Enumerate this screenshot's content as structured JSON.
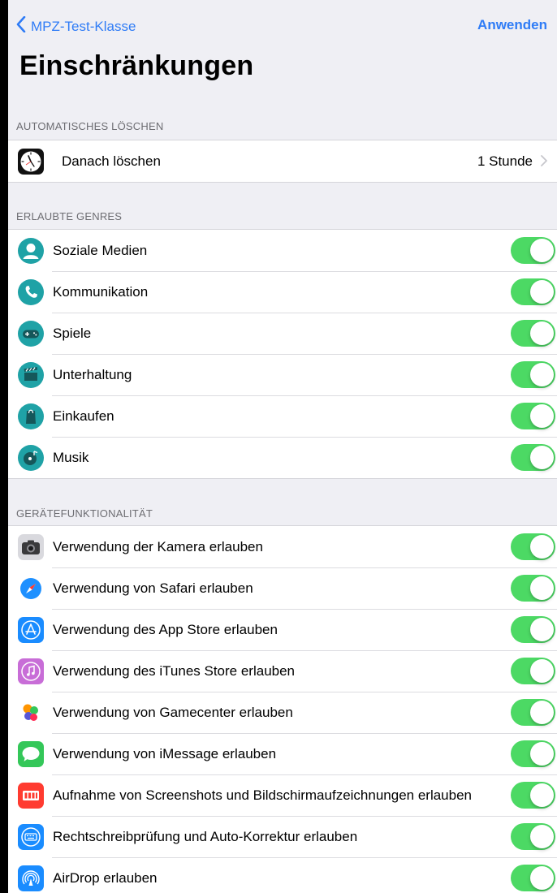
{
  "nav": {
    "back_label": "MPZ-Test-Klasse",
    "apply_label": "Anwenden"
  },
  "title": "Einschränkungen",
  "sections": {
    "auto_delete": {
      "header": "AUTOMATISCHES LÖSCHEN",
      "row": {
        "label": "Danach löschen",
        "value": "1 Stunde",
        "icon": "clock-icon"
      }
    },
    "genres": {
      "header": "ERLAUBTE GENRES",
      "items": [
        {
          "label": "Soziale Medien",
          "icon": "social-media-icon",
          "on": true
        },
        {
          "label": "Kommunikation",
          "icon": "phone-icon",
          "on": true
        },
        {
          "label": "Spiele",
          "icon": "gamepad-icon",
          "on": true
        },
        {
          "label": "Unterhaltung",
          "icon": "clapperboard-icon",
          "on": true
        },
        {
          "label": "Einkaufen",
          "icon": "shopping-bag-icon",
          "on": true
        },
        {
          "label": "Musik",
          "icon": "music-icon",
          "on": true
        }
      ]
    },
    "device": {
      "header": "GERÄTEFUNKTIONALITÄT",
      "items": [
        {
          "label": "Verwendung der Kamera erlauben",
          "icon": "camera-icon",
          "on": true
        },
        {
          "label": "Verwendung von Safari erlauben",
          "icon": "safari-icon",
          "on": true
        },
        {
          "label": "Verwendung des App Store erlauben",
          "icon": "app-store-icon",
          "on": true
        },
        {
          "label": "Verwendung des iTunes Store erlauben",
          "icon": "itunes-icon",
          "on": true
        },
        {
          "label": "Verwendung von Gamecenter erlauben",
          "icon": "game-center-icon",
          "on": true
        },
        {
          "label": "Verwendung von iMessage erlauben",
          "icon": "imessage-icon",
          "on": true
        },
        {
          "label": "Aufnahme von Screenshots und Bildschirmaufzeichnungen erlauben",
          "icon": "screen-recording-icon",
          "on": true
        },
        {
          "label": "Rechtschreibprüfung und Auto-Korrektur erlauben",
          "icon": "keyboard-icon",
          "on": true
        },
        {
          "label": "AirDrop erlauben",
          "icon": "airdrop-icon",
          "on": true
        }
      ]
    }
  },
  "colors": {
    "accent": "#2f7cf6",
    "toggle_on": "#4cd964",
    "genre_icon": "#1fa2a6",
    "background": "#efeff4"
  }
}
